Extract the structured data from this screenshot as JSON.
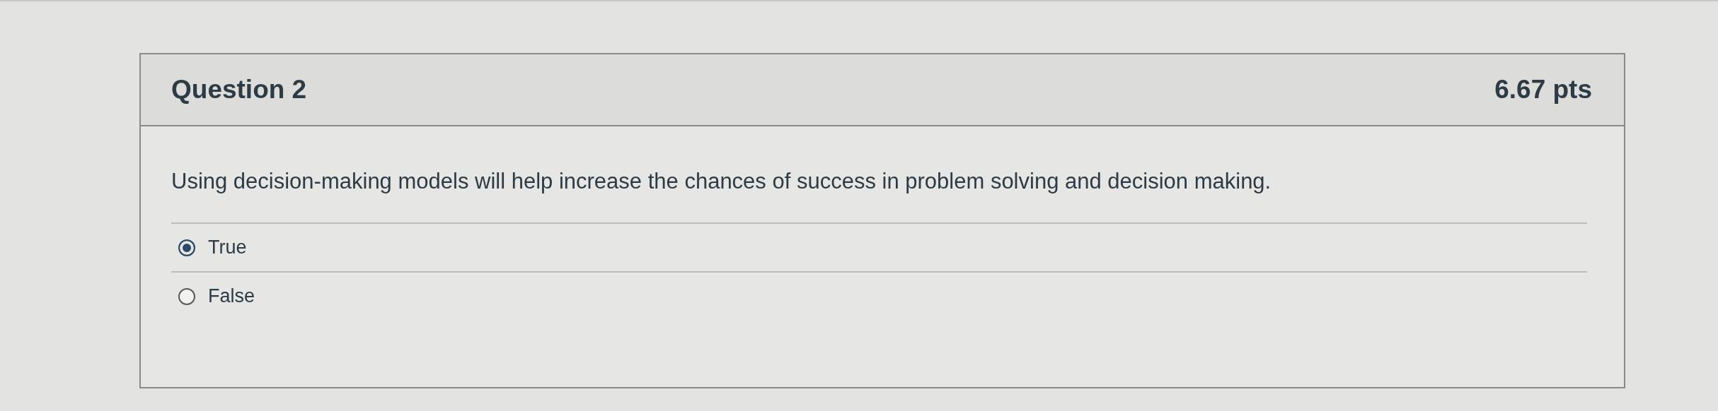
{
  "question": {
    "title": "Question 2",
    "points": "6.67 pts",
    "text": "Using decision-making models will help increase the chances of success in problem solving and decision making.",
    "answers": [
      {
        "label": "True",
        "selected": true
      },
      {
        "label": "False",
        "selected": false
      }
    ]
  }
}
